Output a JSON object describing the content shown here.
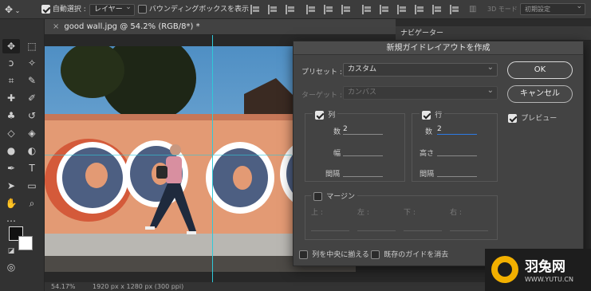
{
  "options_bar": {
    "auto_select_label": "自動選択 :",
    "auto_select_value": "レイヤー",
    "bounding_box_label": "バウンディングボックスを表示",
    "mode_3d_label": "3D モード :",
    "workspace_label": "初期設定"
  },
  "document": {
    "tab_label": "good wall.jpg @ 54.2% (RGB/8*) *",
    "zoom": "54.17%",
    "size_info": "1920 px x 1280 px (300 ppi)"
  },
  "panels": {
    "navigator_tab": "ナビゲーター"
  },
  "dialog": {
    "title": "新規ガイドレイアウトを作成",
    "preset_label": "プリセット :",
    "preset_value": "カスタム",
    "target_label": "ターゲット :",
    "target_value": "カンバス",
    "columns": {
      "label": "列",
      "count_label": "数",
      "count_value": "2",
      "width_label": "幅",
      "gutter_label": "間隔"
    },
    "rows": {
      "label": "行",
      "count_label": "数",
      "count_value": "2",
      "height_label": "高さ",
      "gutter_label": "間隔"
    },
    "margin": {
      "label": "マージン",
      "top": "上 :",
      "left": "左 :",
      "bottom": "下 :",
      "right": "右 :"
    },
    "center_columns_label": "列を中央に揃える",
    "clear_guides_label": "既存のガイドを消去",
    "ok_label": "OK",
    "cancel_label": "キャンセル",
    "preview_label": "プレビュー"
  },
  "watermark": {
    "brand": "羽兔网",
    "url": "WWW.YUTU.CN"
  }
}
